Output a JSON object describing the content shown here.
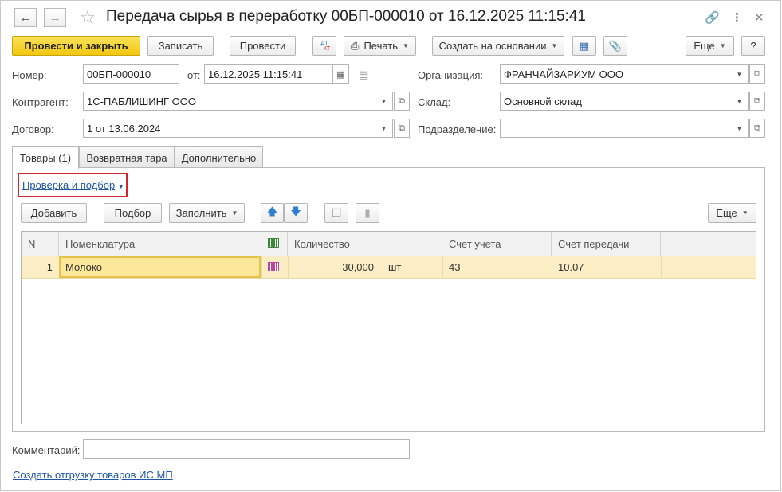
{
  "window": {
    "title": "Передача сырья в переработку 00БП-000010 от 16.12.2025 11:15:41",
    "icons": [
      "back-arrow-icon",
      "forward-arrow-icon",
      "star-icon",
      "link-icon",
      "more-vert-icon",
      "close-icon"
    ]
  },
  "toolbar": {
    "post_close": "Провести и закрыть",
    "save": "Записать",
    "post": "Провести",
    "dt_kt": "ДТ КТ",
    "print": "Печать",
    "create_based": "Создать на основании",
    "more": "Еще",
    "help": "?"
  },
  "header": {
    "number_label": "Номер:",
    "number_value": "00БП-000010",
    "date_label": "от:",
    "date_value": "16.12.2025 11:15:41",
    "org_label": "Организация:",
    "org_value": "ФРАНЧАЙЗАРИУМ ООО",
    "counterparty_label": "Контрагент:",
    "counterparty_value": "1С-ПАБЛИШИНГ ООО",
    "warehouse_label": "Склад:",
    "warehouse_value": "Основной склад",
    "contract_label": "Договор:",
    "contract_value": "1 от 13.06.2024",
    "department_label": "Подразделение:",
    "department_value": ""
  },
  "tabs": [
    {
      "label": "Товары (1)",
      "active": true
    },
    {
      "label": "Возвратная тара",
      "active": false
    },
    {
      "label": "Дополнительно",
      "active": false
    }
  ],
  "goods": {
    "check_selection": "Проверка и подбор",
    "add": "Добавить",
    "select": "Подбор",
    "fill": "Заполнить",
    "more": "Еще",
    "columns": {
      "n": "N",
      "nomenclature": "Номенклатура",
      "quantity": "Количество",
      "account": "Счет учета",
      "transfer_account": "Счет передачи"
    },
    "rows": [
      {
        "n": "1",
        "nomenclature": "Молоко",
        "quantity": "30,000",
        "unit": "шт",
        "account": "43",
        "transfer_account": "10.07"
      }
    ]
  },
  "footer": {
    "comment_label": "Комментарий:",
    "comment_value": "",
    "create_shipment_link": "Создать отгрузку товаров ИС МП"
  },
  "colors": {
    "primary_button": "#f2c710",
    "selected_row": "#fbeec4",
    "link": "#1f57a3",
    "highlight_border": "#d0262e"
  }
}
